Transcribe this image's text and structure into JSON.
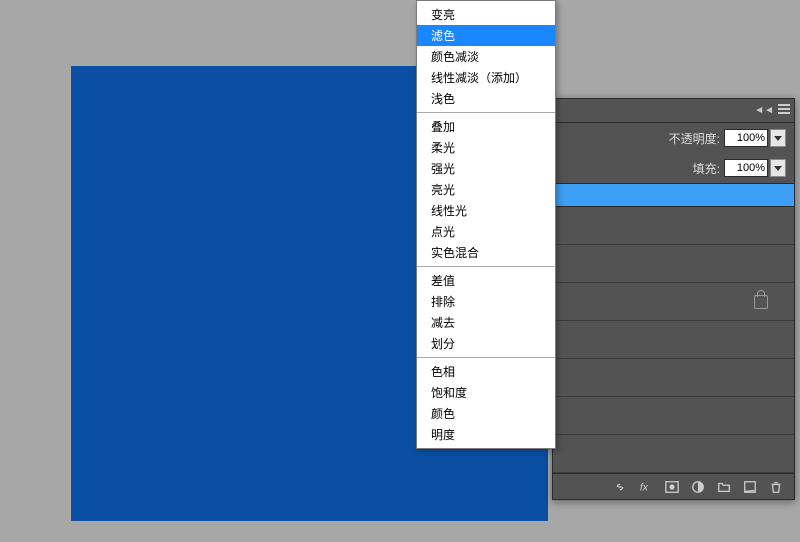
{
  "panel": {
    "opacity_label": "不透明度:",
    "opacity_value": "100%",
    "fill_label": "填充:",
    "fill_value": "100%"
  },
  "menu": {
    "groups": [
      [
        "变亮",
        "滤色",
        "颜色减淡",
        "线性减淡（添加）",
        "浅色"
      ],
      [
        "叠加",
        "柔光",
        "强光",
        "亮光",
        "线性光",
        "点光",
        "实色混合"
      ],
      [
        "差值",
        "排除",
        "减去",
        "划分"
      ],
      [
        "色相",
        "饱和度",
        "颜色",
        "明度"
      ]
    ],
    "selected": "滤色"
  }
}
